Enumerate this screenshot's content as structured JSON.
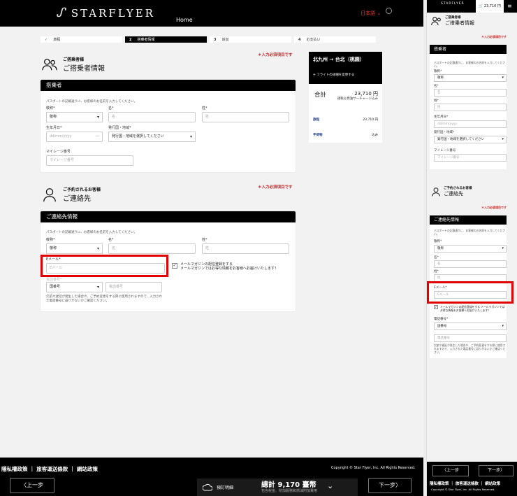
{
  "header": {
    "logo_text": "STARFLYER",
    "home_label": "Home",
    "language": "日本語"
  },
  "steps": [
    {
      "num": "✓",
      "label": "旅程"
    },
    {
      "num": "2",
      "label": "搭乗者情報"
    },
    {
      "num": "3",
      "label": "追加"
    },
    {
      "num": "4",
      "label": "お支払い"
    }
  ],
  "required_note": "＊入力必須項目です",
  "passenger_section": {
    "small_title": "ご搭乗者様",
    "big_title": "ご搭乗者情報",
    "card_title": "搭乗者"
  },
  "contact_section": {
    "small_title": "ご予約されるお客様",
    "big_title": "ご連絡先",
    "card_title": "ご連絡先情報"
  },
  "form": {
    "passport_note": "パスポートの記載通りに、お客様のお名前を入力してください。",
    "title_label": "敬称*",
    "title_value": "敬称",
    "first_name_label": "名*",
    "first_name_placeholder": "名",
    "last_name_label": "姓*",
    "last_name_placeholder": "姓",
    "dob_label": "生年月日*",
    "dob_placeholder": "dd/mm/yyyy",
    "nationality_label": "発行国・地域*",
    "nationality_value": "発行国・地域を選択してください",
    "mileage_label": "マイレージ番号",
    "mileage_placeholder": "マイレージ番号",
    "email_label": "Eメール*",
    "email_placeholder": "Eメール",
    "phone_label": "電話番号*",
    "country_code_value": "国番号",
    "phone_placeholder": "電話番号",
    "phone_note": "欠航や遅延が発生した場合や、ご予約変更をする際に使用されますので、入力された電話番号に誤りがないかご確認ください。",
    "newsletter_line1": "メールマガジンの配信登録をする",
    "newsletter_line2": "メールマガジンではお得な情報をお客様へお届けいたします！",
    "phone_note_short": "欠航や遅延が発生した場合や、ご予約変更をする際に使用されますので、入力された電話番号に誤りがないかご確認ください。"
  },
  "summary": {
    "route": "北九州 → 台北（桃園）",
    "change_flight": "フライトの詳細を変更する",
    "total_label": "合計",
    "total_value": "23,710 円",
    "total_note": "諸税＆燃油サーチャージ込み",
    "fare_label": "旅程",
    "fare_value": "23,710 円",
    "baggage_label": "手荷物",
    "baggage_value": "込み"
  },
  "footer": {
    "links": "隱私權政策 ｜ 旅客運送條款 ｜ 網站政策",
    "copyright": "Copyright © Star Flyer, Inc. All Rights Reserved.",
    "back_label": "〈上一步",
    "next_label": "下一步〉",
    "detail_label": "預訂明細",
    "total": "總計 9,170 臺幣",
    "total_sub": "包含稅金、附加服務和燃油附加費用"
  },
  "mobile": {
    "cart_value": "23,710 円",
    "back_label": "〈上一步",
    "next_label": "下一步〉",
    "links": "隱私權政策 ｜ 旅客運送條款 ｜ 網站政策",
    "copyright": "Copyright © Star Flyer, Inc. All Rights Reserved.",
    "dob_placeholder": "dd/mm/yyyy",
    "newsletter": "メールマガジンの配信登録をする メールマガジンではお得な情報をお客様へお届けいたします！"
  },
  "colors": {
    "accent_red": "#e10000",
    "required_red": "#c62828",
    "header_bg": "#000000"
  }
}
